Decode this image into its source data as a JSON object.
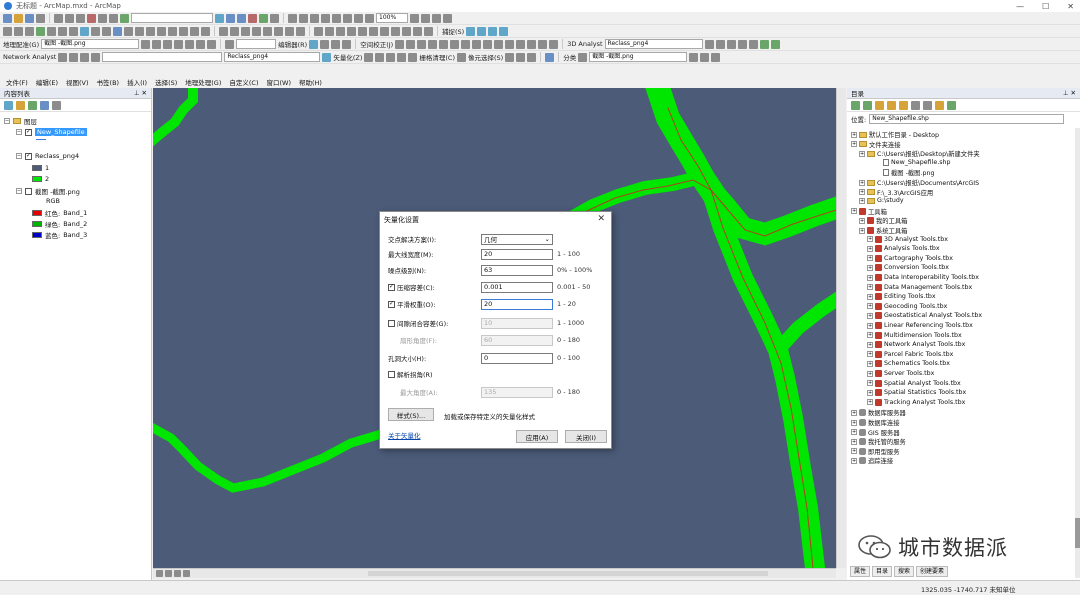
{
  "window": {
    "title": "无标题 - ArcMap.mxd - ArcMap",
    "min": "—",
    "max": "☐",
    "close": "✕"
  },
  "toolbars": {
    "scale_value": "",
    "zoom_value": "100%",
    "georef_label": "地理配准(G)",
    "georef_layer": "截图 -截图.png",
    "adjust_label": "编辑器(R)",
    "spatial_adjust": "空间校正(J)",
    "network_analyst": "Network Analyst",
    "raster_layer": "Reclass_png4",
    "vectorize_label": "矢量化(Z)",
    "raster_cleanup": "栅格清理(C)",
    "cell_select": "像元选择(S)",
    "classify_label": "分类",
    "classify_layer": "截图 -截图.png",
    "analyst_3d": "3D Analyst",
    "analyst_layer": "Reclass_png4",
    "capture_label": "捕捉(S)"
  },
  "menu": [
    "文件(F)",
    "编辑(E)",
    "视图(V)",
    "书签(B)",
    "插入(I)",
    "选择(S)",
    "地理处理(G)",
    "自定义(C)",
    "窗口(W)",
    "帮助(H)"
  ],
  "toc": {
    "title": "内容列表",
    "pin": "⊥ ✕",
    "layers_root": "图层",
    "layer1": "New_Shapefile",
    "layer2": "Reclass_png4",
    "layer2_class1": "1",
    "layer2_class2": "2",
    "layer3": "截图 -截图.png",
    "layer3_rgb": "RGB",
    "band_red": "红色:",
    "band_red_name": "Band_1",
    "band_green": "绿色:",
    "band_green_name": "Band_2",
    "band_blue": "蓝色:",
    "band_blue_name": "Band_3",
    "colors": {
      "class1": "#4b5b78",
      "class2": "#00e600",
      "red": "#e60000",
      "green": "#00b400",
      "blue": "#0000c8"
    }
  },
  "dialog": {
    "title": "矢量化设置",
    "close": "✕",
    "intersection_label": "交点解决方案(I):",
    "intersection_value": "几何",
    "max_width_label": "最大线宽度(M):",
    "max_width_value": "20",
    "max_width_range": "1 - 100",
    "noise_label": "噪点级别(N):",
    "noise_value": "63",
    "noise_range": "0% - 100%",
    "compress_label": "压缩容差(C):",
    "compress_value": "0.001",
    "compress_range": "0.001 - 50",
    "smooth_label": "平滑权重(O):",
    "smooth_value": "20",
    "smooth_range": "1 - 20",
    "gap_label": "间隙闭合容差(G):",
    "gap_value": "10",
    "gap_range": "1 - 1000",
    "fan_label": "扇形角度(F):",
    "fan_value": "60",
    "fan_range": "0 - 180",
    "hole_label": "孔洞大小(H):",
    "hole_value": "0",
    "hole_range": "0 - 100",
    "resolve_label": "解析拐角(R)",
    "min_angle_label": "最大角度(A):",
    "min_angle_value": "135",
    "min_angle_range": "0 - 180",
    "style_button": "样式(S)...",
    "style_desc": "加载或保存特定义的矢量化样式",
    "about_link": "关于矢量化",
    "apply_button": "应用(A)",
    "close_button": "关闭(I)",
    "compress_checked": true,
    "smooth_checked": true,
    "gap_checked": false,
    "resolve_checked": false
  },
  "catalog": {
    "title": "目录",
    "pin": "⊥ ✕",
    "location_label": "位置:",
    "location_value": "New_Shapefile.shp",
    "items": [
      "默认工作目录 - Desktop",
      "文件夹连接",
      "C:\\Users\\报纸\\Desktop\\新建文件夹",
      "New_Shapefile.shp",
      "截图 -截图.png",
      "C:\\Users\\报纸\\Documents\\ArcGIS",
      "F:\\_3.3\\ArcGIS应用",
      "G:\\study",
      "工具箱",
      "我的工具箱",
      "系统工具箱",
      "3D Analyst Tools.tbx",
      "Analysis Tools.tbx",
      "Cartography Tools.tbx",
      "Conversion Tools.tbx",
      "Data Interoperability Tools.tbx",
      "Data Management Tools.tbx",
      "Editing Tools.tbx",
      "Geocoding Tools.tbx",
      "Geostatistical Analyst Tools.tbx",
      "Linear Referencing Tools.tbx",
      "Multidimension Tools.tbx",
      "Network Analyst Tools.tbx",
      "Parcel Fabric Tools.tbx",
      "Schematics Tools.tbx",
      "Server Tools.tbx",
      "Spatial Analyst Tools.tbx",
      "Spatial Statistics Tools.tbx",
      "Tracking Analyst Tools.tbx",
      "数据库服务器",
      "数据库连接",
      "GIS 服务器",
      "我托管的服务",
      "即用型服务",
      "追踪连接"
    ],
    "tabs": [
      "属性",
      "目录",
      "搜索",
      "创建要素"
    ]
  },
  "status": {
    "coords": "1325.035  -1740.717 未知单位"
  },
  "watermark": {
    "text": "城市数据派"
  },
  "colors": {
    "map_bg": "#4b5b78",
    "river": "#00e600",
    "river_line": "#b04020",
    "arrow": "#e03030",
    "selection": "#3399ff"
  }
}
